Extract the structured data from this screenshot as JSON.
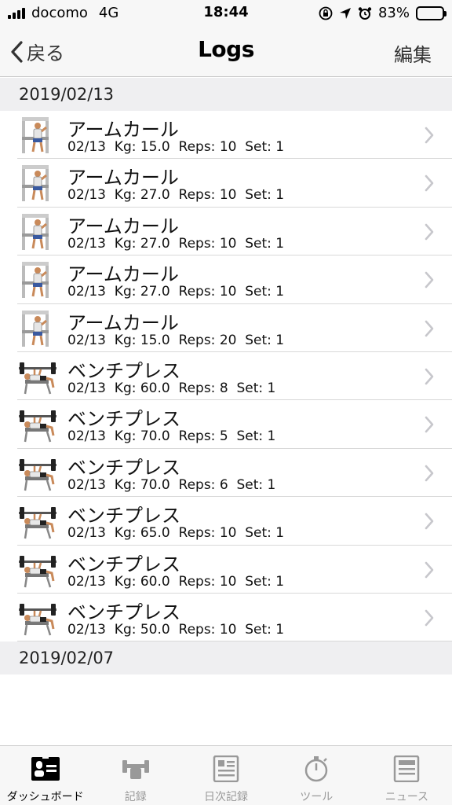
{
  "status_bar": {
    "carrier": "docomo",
    "network": "4G",
    "time": "18:44",
    "battery": "83%",
    "battery_level": 0.83
  },
  "nav": {
    "back_label": "戻る",
    "title": "Logs",
    "edit_label": "編集"
  },
  "sections": [
    {
      "date": "2019/02/13",
      "rows": [
        {
          "name": "アームカール",
          "detail": "02/13  Kg: 15.0  Reps: 10  Set: 1",
          "icon": "arm-curl"
        },
        {
          "name": "アームカール",
          "detail": "02/13  Kg: 27.0  Reps: 10  Set: 1",
          "icon": "arm-curl"
        },
        {
          "name": "アームカール",
          "detail": "02/13  Kg: 27.0  Reps: 10  Set: 1",
          "icon": "arm-curl"
        },
        {
          "name": "アームカール",
          "detail": "02/13  Kg: 27.0  Reps: 10  Set: 1",
          "icon": "arm-curl"
        },
        {
          "name": "アームカール",
          "detail": "02/13  Kg: 15.0  Reps: 20  Set: 1",
          "icon": "arm-curl"
        },
        {
          "name": "ベンチプレス",
          "detail": "02/13  Kg: 60.0  Reps: 8  Set: 1",
          "icon": "bench-press"
        },
        {
          "name": "ベンチプレス",
          "detail": "02/13  Kg: 70.0  Reps: 5  Set: 1",
          "icon": "bench-press"
        },
        {
          "name": "ベンチプレス",
          "detail": "02/13  Kg: 70.0  Reps: 6  Set: 1",
          "icon": "bench-press"
        },
        {
          "name": "ベンチプレス",
          "detail": "02/13  Kg: 65.0  Reps: 10  Set: 1",
          "icon": "bench-press"
        },
        {
          "name": "ベンチプレス",
          "detail": "02/13  Kg: 60.0  Reps: 10  Set: 1",
          "icon": "bench-press"
        },
        {
          "name": "ベンチプレス",
          "detail": "02/13  Kg: 50.0  Reps: 10  Set: 1",
          "icon": "bench-press"
        }
      ]
    },
    {
      "date": "2019/02/07",
      "rows": []
    }
  ],
  "tabs": [
    {
      "label": "ダッシュボード",
      "icon": "dashboard-icon",
      "active": true
    },
    {
      "label": "記録",
      "icon": "dumbbell-icon",
      "active": false
    },
    {
      "label": "日次記録",
      "icon": "daily-log-icon",
      "active": false
    },
    {
      "label": "ツール",
      "icon": "stopwatch-icon",
      "active": false
    },
    {
      "label": "ニュース",
      "icon": "news-icon",
      "active": false
    }
  ],
  "colors": {
    "bar_background": "#f7f7f7",
    "section_background": "#efeff1",
    "chevron": "#c7c7cc",
    "tab_inactive": "#999999",
    "tab_active": "#000000"
  }
}
